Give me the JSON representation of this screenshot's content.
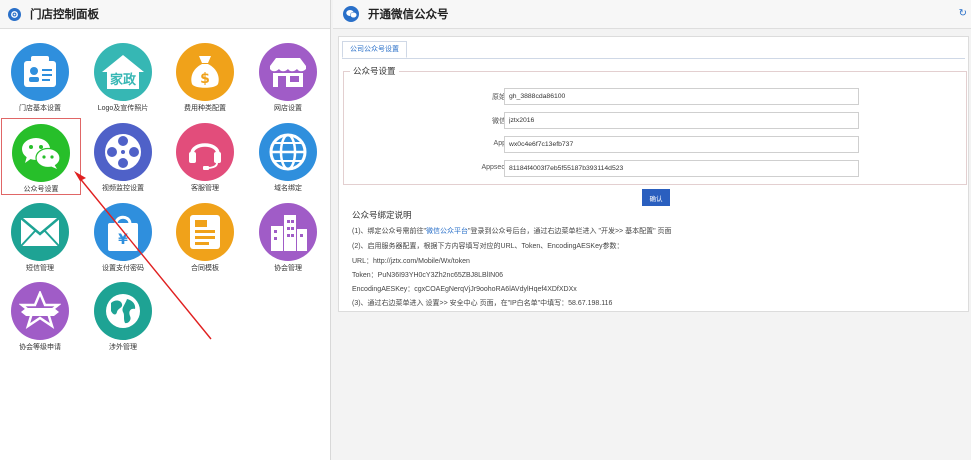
{
  "left_panel": {
    "title": "门店控制面板",
    "tiles": [
      {
        "label": "门店基本设置",
        "color": "#2f8fdd"
      },
      {
        "label": "Logo及宣传照片",
        "color": "#36b7b4",
        "badge": "家政"
      },
      {
        "label": "费用种类配置",
        "color": "#f0a21a",
        "badge": "$"
      },
      {
        "label": "网店设置",
        "color": "#a05cc7"
      },
      {
        "label": "公众号设置",
        "color": "#27bf2a"
      },
      {
        "label": "视频监控设置",
        "color": "#4f61c8"
      },
      {
        "label": "客服管理",
        "color": "#e24d7b"
      },
      {
        "label": "域名绑定",
        "color": "#2f8fdd"
      },
      {
        "label": "短信管理",
        "color": "#1ea394"
      },
      {
        "label": "设置支付密码",
        "color": "#2f8fdd",
        "badge": "¥"
      },
      {
        "label": "合同模板",
        "color": "#f0a21a"
      },
      {
        "label": "协会管理",
        "color": "#a05cc7"
      },
      {
        "label": "协会等级申请",
        "color": "#a05cc7"
      },
      {
        "label": "涉外管理",
        "color": "#1ea394"
      }
    ]
  },
  "right_panel": {
    "title": "开通微信公众号",
    "tab_label": "公司公众号设置",
    "fieldset_legend": "公众号设置",
    "fields": [
      {
        "label": "原始ID",
        "value": "gh_3888cda86100"
      },
      {
        "label": "微信号",
        "value": "jztx2016"
      },
      {
        "label": "AppID",
        "value": "wx0c4e6f7c13efb737"
      },
      {
        "label": "Appsecret",
        "value": "81184f4003f7eb5f55187b393114d523"
      }
    ],
    "confirm_label": "确认",
    "instructions_title": "公众号绑定说明",
    "instructions": {
      "l1_pre": "(1)、绑定公众号需前往\"",
      "l1_link": "微信公众平台",
      "l1_post": "\"登录到公众号后台，通过右边菜单栏进入 \"开发>> 基本配置\" 页面",
      "l2": "(2)、启用服务器配置，根据下方内容填写对应的URL、Token、EncodingAESKey参数：",
      "l3": "URL：http://jztx.com/Mobile/Wx/token",
      "l4": "Token：PuN36I93YH0cY3Zh2nc65ZBJ8LBlIN06",
      "l5": "EncodingAESKey：cgxCOAEgNerqVjJr9oohoRA6lAVdylHqef4XDfXDXx",
      "l6": "(3)、通过右边菜单进入 设置>> 安全中心 页面，在\"IP白名单\"中填写：58.67.198.116"
    }
  },
  "colors": {
    "accent": "#2a70c9",
    "confirm": "#2a5fbf",
    "annotation_arrow": "#e02020"
  }
}
